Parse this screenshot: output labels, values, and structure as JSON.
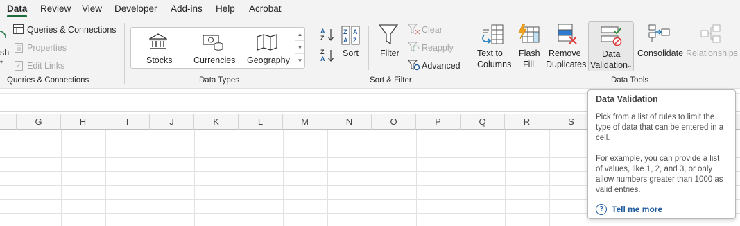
{
  "tabs": [
    "Data",
    "Review",
    "View",
    "Developer",
    "Add-ins",
    "Help",
    "Acrobat"
  ],
  "queries": {
    "refresh_partial": "sh",
    "queries_connections": "Queries & Connections",
    "properties": "Properties",
    "edit_links": "Edit Links",
    "group_label": "Queries & Connections"
  },
  "data_types": {
    "stocks": "Stocks",
    "currencies": "Currencies",
    "geography": "Geography",
    "group_label": "Data Types"
  },
  "sort_filter": {
    "sort": "Sort",
    "filter": "Filter",
    "clear": "Clear",
    "reapply": "Reapply",
    "advanced": "Advanced",
    "group_label": "Sort & Filter"
  },
  "data_tools": {
    "text_to_columns_1": "Text to",
    "text_to_columns_2": "Columns",
    "flash_fill_1": "Flash",
    "flash_fill_2": "Fill",
    "remove_duplicates_1": "Remove",
    "remove_duplicates_2": "Duplicates",
    "data_validation_1": "Data",
    "data_validation_2": "Validation",
    "consolidate": "Consolidate",
    "relationships": "Relationships",
    "group_label": "Data Tools"
  },
  "columns": [
    "G",
    "H",
    "I",
    "J",
    "K",
    "L",
    "M",
    "N",
    "O",
    "P",
    "Q",
    "R",
    "S"
  ],
  "tooltip": {
    "title": "Data Validation",
    "para1": "Pick from a list of rules to limit the type of data that can be entered in a cell.",
    "para2": "For example, you can provide a list of values, like 1, 2, and 3, or only allow numbers greater than 1000 as valid entries.",
    "link": "Tell me more"
  },
  "colors": {
    "accent_green": "#1e6b3c",
    "link_blue": "#1f5b9e"
  }
}
